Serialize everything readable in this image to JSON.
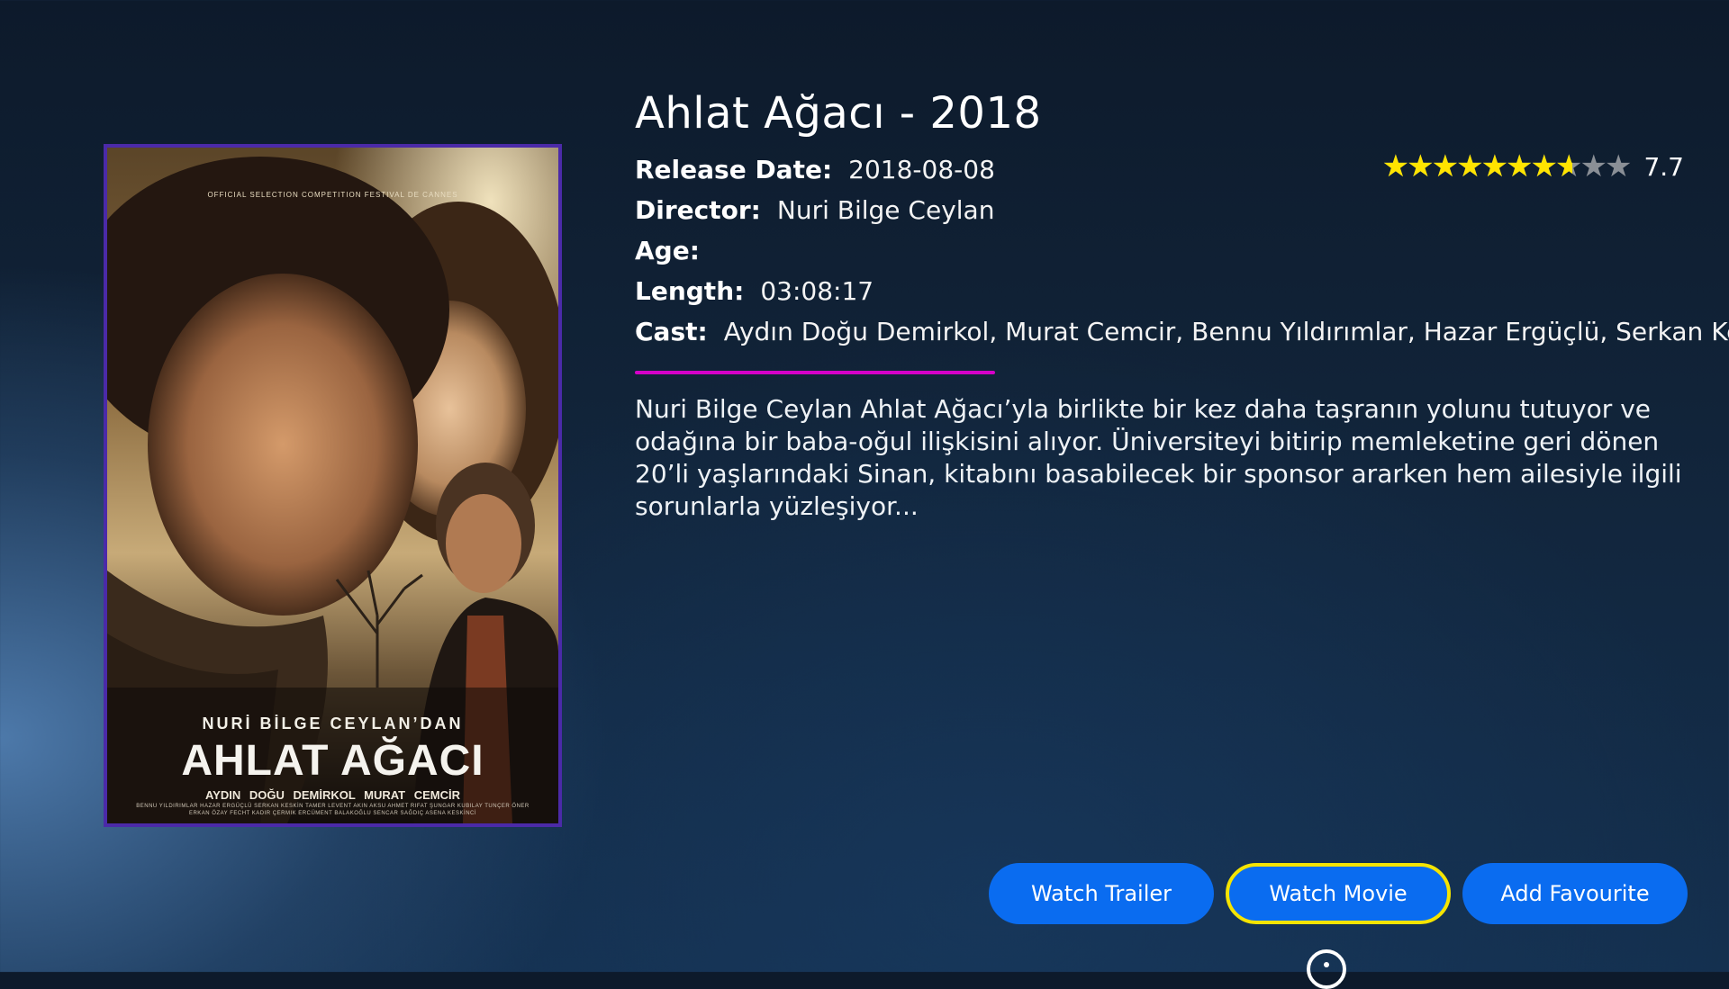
{
  "movie": {
    "title": "Ahlat Ağacı - 2018",
    "release_label": "Release Date:",
    "release_value": "2018-08-08",
    "director_label": "Director:",
    "director_value": "Nuri Bilge Ceylan",
    "age_label": "Age:",
    "age_value": "",
    "length_label": "Length:",
    "length_value": "03:08:17",
    "cast_label": "Cast:",
    "cast_value": "Aydın Doğu Demirkol, Murat Cemcir, Bennu Yıldırımlar, Hazar Ergüçlü, Serkan Keskin",
    "rating_value": "7.7",
    "rating_fraction": 0.77,
    "stars_max": 10,
    "description": "Nuri Bilge Ceylan Ahlat Ağacı’yla birlikte bir kez daha taşranın yolunu tutuyor ve odağına bir baba-oğul ilişkisini alıyor. Üniversiteyi bitirip memleketine geri dönen 20’li yaşlarındaki Sinan, kitabını basabilecek bir sponsor ararken hem ailesiyle ilgili sorunlarla yüzleşiyor..."
  },
  "poster": {
    "festival": "OFFICIAL SELECTION COMPETITION FESTIVAL DE CANNES",
    "director_line": "NURİ BİLGE CEYLAN’DAN",
    "title": "AHLAT AĞACI",
    "leads": "AYDIN DOĞU DEMİRKOL   MURAT CEMCİR",
    "credits": "BENNU YILDIRIMLAR  HAZAR ERGÜÇLÜ  SERKAN KESKİN  TAMER LEVENT  AKIN AKSU  AHMET RIFAT ŞUNGAR  KUBILAY TUNÇER  ÖNER ERKAN  ÖZAY FECHT  KADIR ÇERMIK  ERCÜMENT BALAKOĞLU  SENCAR SAĞDIÇ  ASENA KESKİNCİ"
  },
  "buttons": {
    "trailer": "Watch Trailer",
    "movie": "Watch Movie",
    "favourite": "Add Favourite"
  },
  "colors": {
    "accent_divider": "#d400c8",
    "button_blue": "#0a6cf0",
    "focus_yellow": "#f5e400",
    "star_yellow": "#ffe400",
    "poster_border": "#4b2aa8"
  }
}
